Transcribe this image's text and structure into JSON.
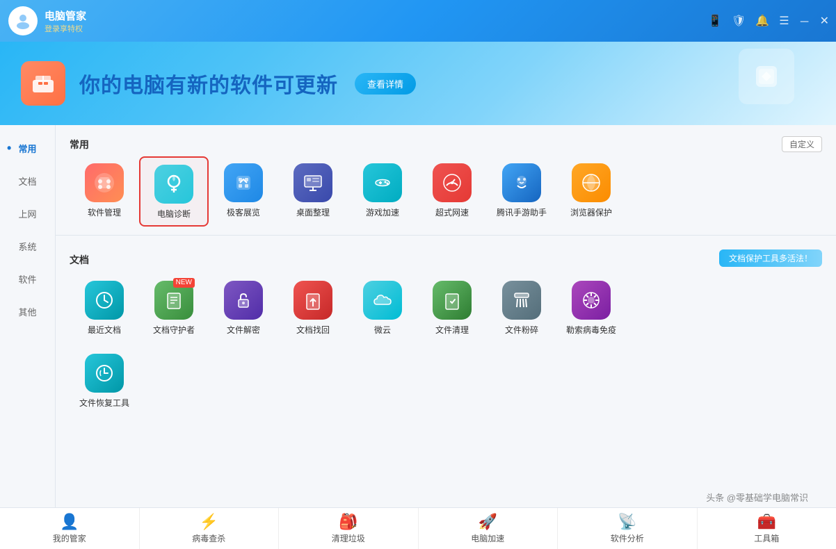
{
  "titlebar": {
    "app_name": "电脑管家",
    "subtitle": "登录享特权",
    "controls": [
      "mobile-icon",
      "shield-icon",
      "gift-icon",
      "menu-icon",
      "minimize-icon",
      "close-icon"
    ]
  },
  "banner": {
    "text": "你的电脑有新的软件可更新",
    "button_label": "查看详情"
  },
  "sidebar": {
    "items": [
      {
        "id": "common",
        "label": "常用",
        "active": true
      },
      {
        "id": "document",
        "label": "文档"
      },
      {
        "id": "network",
        "label": "上网"
      },
      {
        "id": "system",
        "label": "系统"
      },
      {
        "id": "software",
        "label": "软件"
      },
      {
        "id": "other",
        "label": "其他"
      }
    ]
  },
  "sections": {
    "common": {
      "title": "常用",
      "customize_label": "自定义",
      "items": [
        {
          "id": "software-manage",
          "label": "软件管理",
          "icon_class": "icon-software"
        },
        {
          "id": "diagnose",
          "label": "电脑诊断",
          "icon_class": "icon-diagnose",
          "selected": true
        },
        {
          "id": "restore-point",
          "label": "极客展览",
          "icon_class": "icon-restore"
        },
        {
          "id": "desktop",
          "label": "桌面整理",
          "icon_class": "icon-desktop"
        },
        {
          "id": "game",
          "label": "游戏加速",
          "icon_class": "icon-game"
        },
        {
          "id": "speed",
          "label": "超式网速",
          "icon_class": "icon-speed"
        },
        {
          "id": "tencent",
          "label": "腾讯手游助手",
          "icon_class": "icon-tencent"
        },
        {
          "id": "browser",
          "label": "浏览器保护",
          "icon_class": "icon-browser"
        }
      ]
    },
    "document": {
      "title": "文档",
      "banner_text": "文档保护工具多活法！",
      "items": [
        {
          "id": "recent-doc",
          "label": "最近文档",
          "icon_class": "icon-recent"
        },
        {
          "id": "guardian",
          "label": "文档守护者",
          "icon_class": "icon-guardian",
          "badge": "NEW"
        },
        {
          "id": "unlock",
          "label": "文件解密",
          "icon_class": "icon-unlock"
        },
        {
          "id": "recover",
          "label": "文档找回",
          "icon_class": "icon-recover"
        },
        {
          "id": "cloud",
          "label": "微云",
          "icon_class": "icon-cloud"
        },
        {
          "id": "cleanup",
          "label": "文件清理",
          "icon_class": "icon-cleanup"
        },
        {
          "id": "shred",
          "label": "文件粉碎",
          "icon_class": "icon-shred"
        },
        {
          "id": "antivirus",
          "label": "勒索病毒免疫",
          "icon_class": "icon-antivirus"
        }
      ],
      "extra_items": [
        {
          "id": "filerestore",
          "label": "文件恢复工具",
          "icon_class": "icon-filerestore"
        }
      ]
    }
  },
  "bottom_nav": {
    "items": [
      {
        "id": "manager",
        "label": "我的管家",
        "icon": "👤"
      },
      {
        "id": "antivirus",
        "label": "病毒查杀",
        "icon": "⚡"
      },
      {
        "id": "cleanup",
        "label": "清理垃圾",
        "icon": "🎒"
      },
      {
        "id": "boost",
        "label": "电脑加速",
        "icon": "🚀"
      },
      {
        "id": "software-analyze",
        "label": "软件分析",
        "icon": "📡"
      },
      {
        "id": "toolbar",
        "label": "工具箱",
        "icon": "🧰"
      }
    ]
  },
  "watermark": {
    "text": "头条 @零基础学电脑常识"
  }
}
